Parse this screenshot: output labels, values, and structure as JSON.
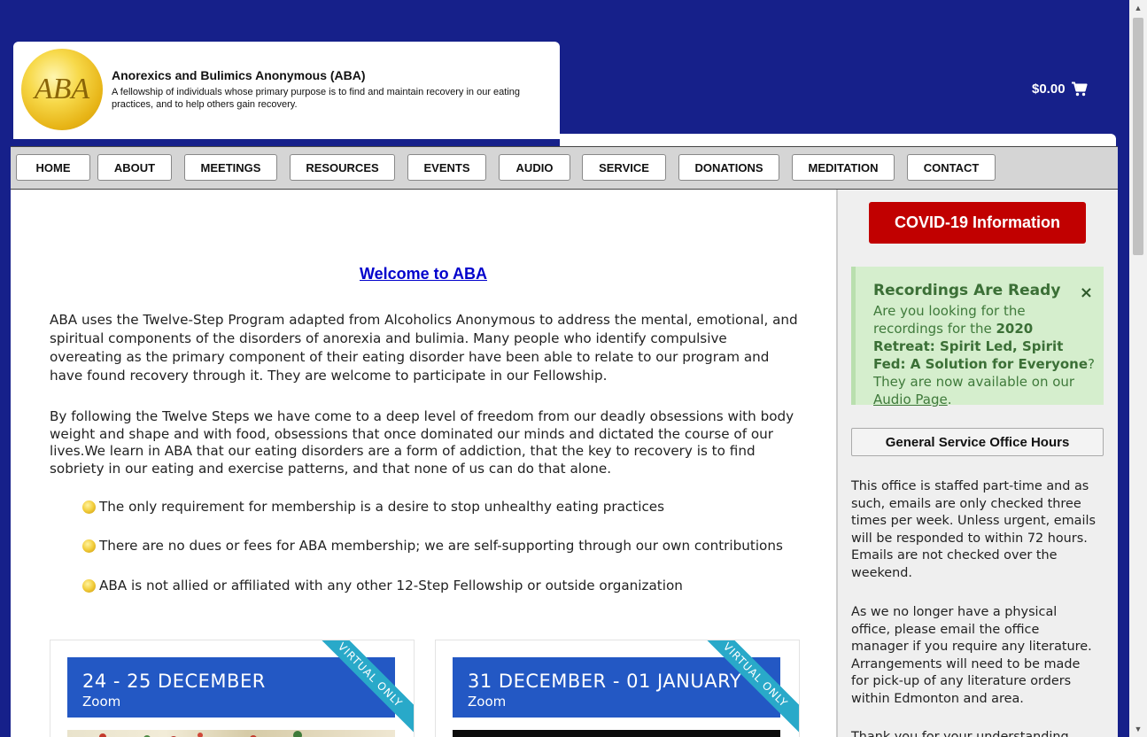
{
  "header": {
    "logo_text": "ABA",
    "site_title": "Anorexics and Bulimics Anonymous (ABA)",
    "tagline": "A fellowship of individuals whose primary purpose is to find and maintain recovery in our eating practices, and to help others gain recovery.",
    "cart_total": "$0.00"
  },
  "nav": {
    "items": [
      {
        "label": "HOME"
      },
      {
        "label": "ABOUT"
      },
      {
        "label": "MEETINGS"
      },
      {
        "label": "RESOURCES"
      },
      {
        "label": "EVENTS"
      },
      {
        "label": "AUDIO"
      },
      {
        "label": "SERVICE"
      },
      {
        "label": "DONATIONS"
      },
      {
        "label": "MEDITATION"
      },
      {
        "label": "CONTACT"
      }
    ]
  },
  "main": {
    "welcome_link": "Welcome to ABA",
    "paragraph1": "ABA uses the Twelve-Step Program adapted from Alcoholics Anonymous to address the mental, emotional, and spiritual components of the disorders of anorexia and bulimia. Many people who identify compulsive overeating as the primary component of their eating disorder have been able to relate to our program and have found recovery through it. They are welcome to participate in our Fellowship.",
    "paragraph2": "By following the Twelve Steps we have come to a deep level of freedom from our deadly obsessions with body weight and shape and with food, obsessions that once dominated our minds and dictated the course of our lives.We learn in ABA that our eating disorders are a form of addiction, that the key to recovery is to find sobriety in our eating and exercise patterns, and that none of us can do that alone.",
    "bullets": [
      "The only requirement for membership is a desire to stop unhealthy eating practices",
      "There are no dues or fees for ABA membership; we are self-supporting through our own contributions",
      "ABA is not allied or affiliated with any other 12-Step Fellowship or outside organization"
    ],
    "events": [
      {
        "date": "24 - 25 DECEMBER",
        "location": "Zoom",
        "ribbon": "VIRTUAL ONLY"
      },
      {
        "date": "31 DECEMBER - 01 JANUARY",
        "location": "Zoom",
        "ribbon": "VIRTUAL ONLY"
      }
    ]
  },
  "sidebar": {
    "covid_button": "COVID-19 Information",
    "notice": {
      "title": "Recordings Are Ready",
      "close": "×",
      "text_before": "Are you looking for the recordings for the ",
      "text_bold": "2020 Retreat: Spirit Led, Spirit Fed: A Solution for Everyone",
      "text_middle": "? They are now available on our ",
      "link": "Audio Page",
      "text_after": "."
    },
    "office_button": "General Service Office Hours",
    "office_text1": "This office is staffed part-time and as such, emails are only checked three times per week. Unless urgent, emails will be responded to within 72 hours. Emails are not checked over the weekend.",
    "office_text2": "As we no longer have a physical office, please email the office manager if you require any literature. Arrangements will need to be made for pick-up of  any literature orders within Edmonton and area.",
    "office_text3": "Thank you for your understanding."
  },
  "colors": {
    "background": "#16208a",
    "covid_red": "#c10000",
    "event_blue": "#2358c4",
    "ribbon_teal": "#29a9c9",
    "notice_green_bg": "#d5eecd",
    "notice_green_text": "#3f7a3b",
    "link_blue": "#0000cc"
  },
  "icons": {
    "cart": "cart-icon",
    "bullet": "aba-logo-bullet-icon",
    "close": "close-icon"
  }
}
